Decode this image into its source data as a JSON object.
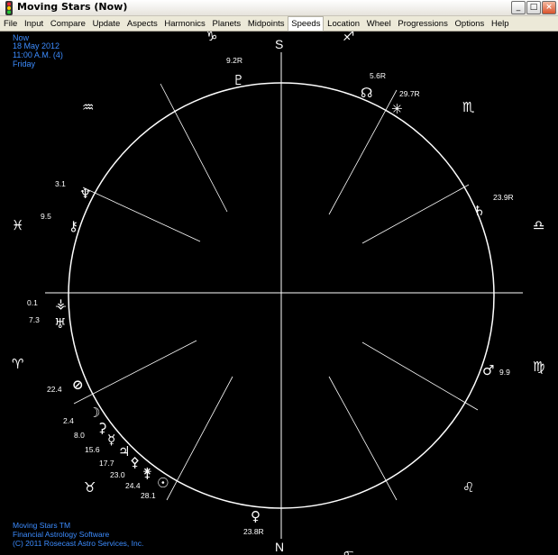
{
  "window": {
    "title": "Moving Stars (Now)",
    "minimize": "_",
    "maximize": "□",
    "close": "×"
  },
  "menu": [
    "File",
    "Input",
    "Compare",
    "Update",
    "Aspects",
    "Harmonics",
    "Planets",
    "Midpoints",
    "Speeds",
    "Location",
    "Wheel",
    "Progressions",
    "Options",
    "Help"
  ],
  "menu_active": "Speeds",
  "info": {
    "label": "Now",
    "date": "18 May 2012",
    "time": "11:00 A.M. (4)",
    "day": "Friday"
  },
  "footer": {
    "product": "Moving Stars TM",
    "subtitle": "Financial Astrology Software",
    "copyright": "(C) 2011 Rosecast Astro Services, Inc."
  },
  "wheel": {
    "top_label": "S",
    "bottom_label": "N",
    "signs": [
      {
        "name": "capricorn",
        "glyph": "♑"
      },
      {
        "name": "sagittarius",
        "glyph": "♐"
      },
      {
        "name": "scorpio",
        "glyph": "♏"
      },
      {
        "name": "libra",
        "glyph": "♎"
      },
      {
        "name": "virgo",
        "glyph": "♍"
      },
      {
        "name": "leo",
        "glyph": "♌"
      },
      {
        "name": "cancer",
        "glyph": "♋"
      },
      {
        "name": "taurus",
        "glyph": "♉"
      },
      {
        "name": "aries",
        "glyph": "♈"
      },
      {
        "name": "pisces",
        "glyph": "♓"
      },
      {
        "name": "aquarius",
        "glyph": "♒"
      }
    ],
    "bodies": [
      {
        "name": "pluto",
        "glyph": "♇",
        "speed": "9.2R"
      },
      {
        "name": "node",
        "glyph": "☊",
        "speed": "5.6R"
      },
      {
        "name": "asteroid",
        "glyph": "✳",
        "speed": "29.7R"
      },
      {
        "name": "saturn",
        "glyph": "♄",
        "speed": "23.9R"
      },
      {
        "name": "mars",
        "glyph": "♂",
        "speed": "9.9"
      },
      {
        "name": "venus",
        "glyph": "♀",
        "speed": "23.8R"
      },
      {
        "name": "neptune",
        "glyph": "♆",
        "speed": "3.1"
      },
      {
        "name": "chiron",
        "glyph": "⚷",
        "speed": "9.5"
      },
      {
        "name": "vesta",
        "glyph": "⚶",
        "speed": "0.1"
      },
      {
        "name": "uranus",
        "glyph": "♅",
        "speed": "7.3"
      },
      {
        "name": "earth",
        "glyph": "⊘",
        "speed": "22.4"
      },
      {
        "name": "moon",
        "glyph": "☽",
        "speed": "2.4"
      },
      {
        "name": "ceres",
        "glyph": "⚳",
        "speed": "8.0"
      },
      {
        "name": "mercury",
        "glyph": "☿",
        "speed": "15.6"
      },
      {
        "name": "jupiter",
        "glyph": "♃",
        "speed": "17.7"
      },
      {
        "name": "pallas",
        "glyph": "⚴",
        "speed": "23.0"
      },
      {
        "name": "juno",
        "glyph": "⚵",
        "speed": "24.4"
      },
      {
        "name": "sun",
        "glyph": "☉",
        "speed": "28.1"
      }
    ]
  }
}
